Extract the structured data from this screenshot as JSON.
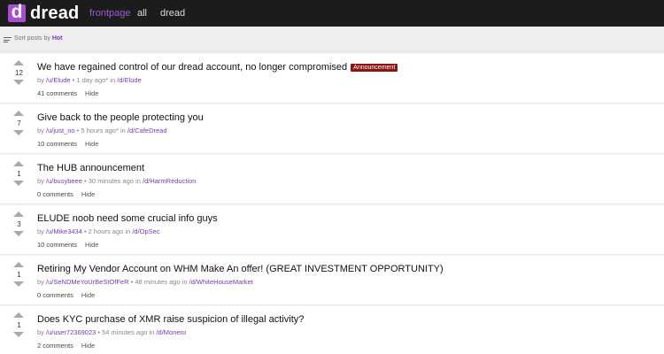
{
  "header": {
    "logo_letter": "d",
    "site_name": "dread",
    "nav": [
      {
        "label": "frontpage",
        "active": true
      },
      {
        "label": "all",
        "active": false
      },
      {
        "label": "dread",
        "active": false
      }
    ]
  },
  "sort": {
    "prefix": "Sort posts by",
    "value": "Hot"
  },
  "posts": [
    {
      "score": "12",
      "title": "We have regained control of our dread account, no longer compromised",
      "badge": "Announcement",
      "by": "by",
      "author": "/u/Elude",
      "time": "• 1 day ago* in",
      "community": "/d/Elude",
      "comments": "41 comments",
      "hide": "Hide"
    },
    {
      "score": "7",
      "title": "Give back to the people protecting you",
      "badge": "",
      "by": "by",
      "author": "/u/just_no",
      "time": "• 5 hours ago* in",
      "community": "/d/CafeDread",
      "comments": "10 comments",
      "hide": "Hide"
    },
    {
      "score": "1",
      "title": "The HUB announcement",
      "badge": "",
      "by": "by",
      "author": "/u/busybeee",
      "time": "• 30 minutes ago in",
      "community": "/d/HarmReduction",
      "comments": "0 comments",
      "hide": "Hide"
    },
    {
      "score": "3",
      "title": "ELUDE noob need some crucial info guys",
      "badge": "",
      "by": "by",
      "author": "/u/Mike3434",
      "time": "• 2 hours ago in",
      "community": "/d/OpSec",
      "comments": "10 comments",
      "hide": "Hide"
    },
    {
      "score": "1",
      "title": "Retiring My Vendor Account on WHM Make An offer! (GREAT INVESTMENT OPPORTUNITY)",
      "badge": "",
      "by": "by",
      "author": "/u/SeNDMeYoUrBeStOfFeR",
      "time": "• 48 minutes ago in",
      "community": "/d/WhiteHouseMarket",
      "comments": "0 comments",
      "hide": "Hide"
    },
    {
      "score": "1",
      "title": "Does KYC purchase of XMR raise suspicion of illegal activity?",
      "badge": "",
      "by": "by",
      "author": "/u/user72369023",
      "time": "• 54 minutes ago in",
      "community": "/d/Monero",
      "comments": "2 comments",
      "hide": "Hide"
    }
  ],
  "colors": {
    "accent": "#a74ed1",
    "link": "#7b38b3",
    "badge": "#8b1414"
  }
}
